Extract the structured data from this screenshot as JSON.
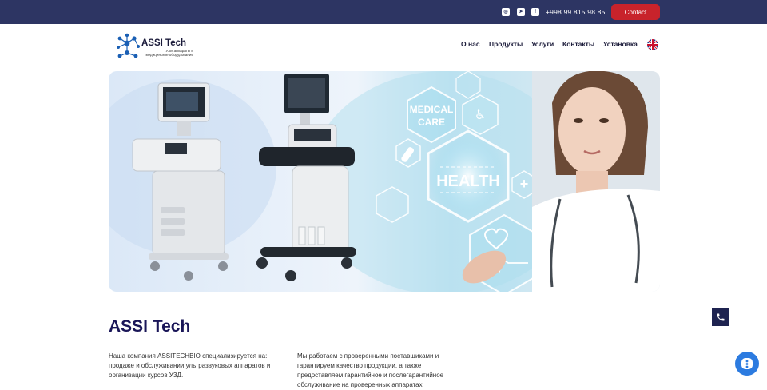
{
  "topbar": {
    "phone": "+998 99 815 98 85",
    "contact_label": "Contact",
    "social_icons": [
      "instagram-icon",
      "telegram-icon",
      "facebook-icon"
    ]
  },
  "logo": {
    "name": "ASSI Tech",
    "subtitle_line1": "УЗИ аппараты и",
    "subtitle_line2": "медицинское оборудование"
  },
  "nav": {
    "items": [
      {
        "label": "О нас"
      },
      {
        "label": "Продукты"
      },
      {
        "label": "Услуги"
      },
      {
        "label": "Контакты"
      },
      {
        "label": "Установка"
      }
    ],
    "language_icon": "uk-flag-icon"
  },
  "banner": {
    "label_medical": "MEDICAL",
    "label_care": "CARE",
    "label_health": "HEALTH"
  },
  "main": {
    "title": "ASSI Tech",
    "paragraph_left": "Наша компания ASSITECHBIO специализируется на: продаже и обслуживании ультразвуковых аппаратов и организации курсов УЗД.",
    "paragraph_right": "Мы работаем с проверенными поставщиками и гарантируем качество продукции, а также предоставляем гарантийное и послегарантийное обслуживание на проверенных аппаратах"
  },
  "colors": {
    "topbar": "#2d3563",
    "contact": "#c8232b",
    "title": "#1a1658",
    "chat": "#2c7be0"
  }
}
